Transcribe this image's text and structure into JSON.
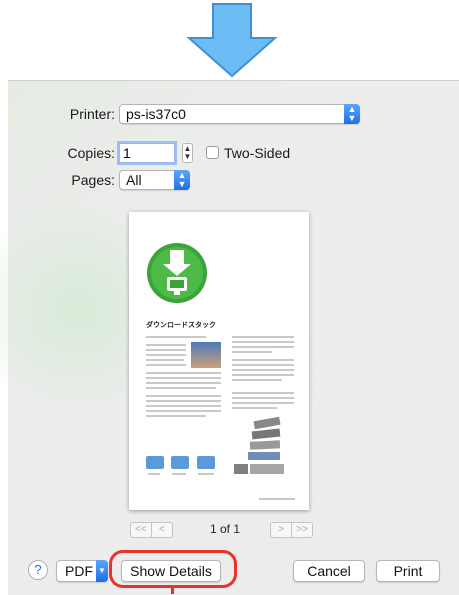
{
  "printer": {
    "label": "Printer:",
    "value": "ps-is37c0"
  },
  "copies": {
    "label": "Copies:",
    "value": "1"
  },
  "two_sided": {
    "label": "Two-Sided",
    "checked": false
  },
  "pages": {
    "label": "Pages:",
    "value": "All"
  },
  "preview": {
    "doc_title": "ダウンロードスタック",
    "page_indicator": "1 of 1",
    "nav": {
      "first": "<<",
      "prev": "<",
      "next": ">",
      "last": ">>"
    }
  },
  "buttons": {
    "help": "?",
    "pdf": "PDF",
    "show_details": "Show Details",
    "cancel": "Cancel",
    "print": "Print"
  },
  "colors": {
    "accent": "#1e6fe8",
    "arrow": "#69b8f5",
    "callout": "#e8322a",
    "doc_icon": "#3aa43a"
  }
}
